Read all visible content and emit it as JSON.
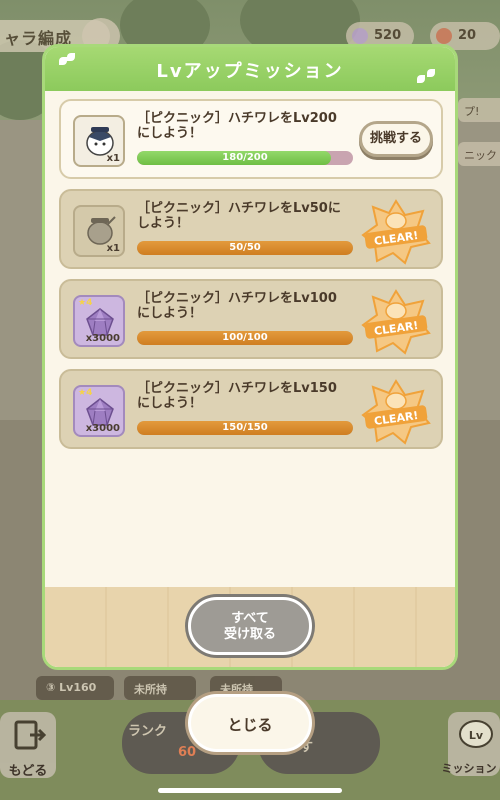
{
  "background": {
    "screen_title": "ャラ編成",
    "currency_1": "520",
    "currency_2": "20",
    "side_tab_1": "プ!",
    "side_tab_2": "ニック",
    "card_1": "③ Lv160",
    "card_2": "未所持",
    "card_3": "未所持",
    "back_label": "もどる",
    "rank_label": "ランク",
    "rank_value": "60",
    "other_label": "す",
    "lv_mission_label": "ミッション"
  },
  "panel": {
    "title": "Lvアップミッション"
  },
  "missions": [
    {
      "text": "［ピクニック］ハチワレをLv200にしよう！",
      "progress_label": "180/200",
      "progress": 0.9,
      "reward_qty": "x1",
      "state": "active",
      "button": "挑戦する"
    },
    {
      "text": "［ピクニック］ハチワレをLv50にしよう！",
      "progress_label": "50/50",
      "progress": 1.0,
      "reward_qty": "x1",
      "state": "cleared",
      "stamp": "CLEAR!"
    },
    {
      "text": "［ピクニック］ハチワレをLv100にしよう！",
      "progress_label": "100/100",
      "progress": 1.0,
      "reward_qty": "x3000",
      "reward_star": "4",
      "state": "cleared",
      "stamp": "CLEAR!"
    },
    {
      "text": "［ピクニック］ハチワレをLv150にしよう！",
      "progress_label": "150/150",
      "progress": 1.0,
      "reward_qty": "x3000",
      "reward_star": "4",
      "state": "cleared",
      "stamp": "CLEAR!"
    }
  ],
  "buttons": {
    "receive_all_line1": "すべて",
    "receive_all_line2": "受け取る",
    "close": "とじる"
  },
  "colors": {
    "header_green": "#8cca5c",
    "progress_green": "#6fbe44",
    "progress_orange": "#cf7e22",
    "stamp_orange": "#f0a23a"
  }
}
